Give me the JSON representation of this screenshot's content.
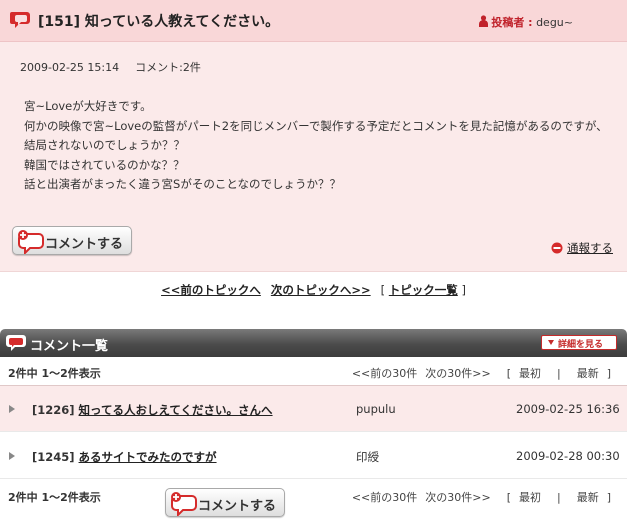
{
  "topic": {
    "title": "[151] 知っている人教えてください。",
    "poster_label": "投稿者 :",
    "poster_name": "degu~",
    "date": "2009-02-25 15:14",
    "comment_count": "コメント:2件",
    "body": [
      "宮~Loveが大好きです。",
      "何かの映像で宮~Loveの監督がパート2を同じメンバーで製作する予定だとコメントを見た記憶があるのですが、結局されないのでしょうか？？",
      "韓国ではされているのかな？？",
      "話と出演者がまったく違う宮Sがそのことなのでしょうか？？"
    ],
    "comment_button": "コメントする",
    "report_link": "通報する"
  },
  "topic_nav": {
    "prev": "<<前のトピックへ",
    "next": "次のトピックへ>>",
    "list": "トピック一覧",
    "bracket_open": "[",
    "bracket_close": "]"
  },
  "comments": {
    "header": "コメント一覧",
    "detail_button": "詳細を見る",
    "count_text": "2件中 1～2件表示",
    "pager": {
      "prev": "<<前の30件",
      "next": "次の30件>>",
      "bracket_open": "[",
      "first": "最初",
      "divider": "|",
      "last": "最新",
      "bracket_close": "]"
    },
    "rows": [
      {
        "id": "[1226]",
        "title": "知ってる人おしえてください。さんへ",
        "author": "pupulu",
        "date": "2009-02-25 16:36"
      },
      {
        "id": "[1245]",
        "title": "あるサイトでみたのですが",
        "author": "印綬",
        "date": "2009-02-28 00:30"
      }
    ],
    "bottom_comment_button": "コメントする"
  },
  "colors": {
    "accent_red": "#c0222b",
    "topic_bg": "#fbeaea",
    "header_bg": "#f9d7d8",
    "list_header": "#4b4b4b"
  },
  "icons": [
    "speech-bubble-icon",
    "person-icon",
    "comment-add-icon",
    "no-entry-icon",
    "chevron-down-icon",
    "row-arrow-icon"
  ]
}
